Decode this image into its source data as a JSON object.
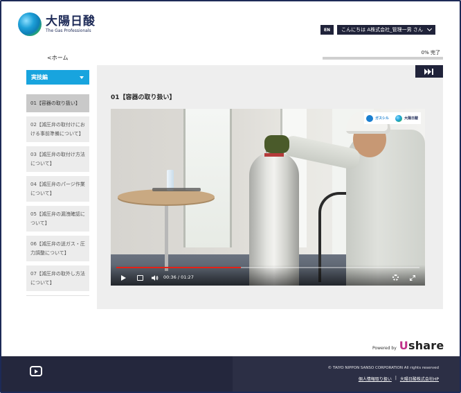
{
  "header": {
    "logo_jp": "大陽日酸",
    "logo_en": "The Gas Professionals",
    "lang_button": "EN",
    "user_greeting": "こんにちは A株式会社_管理一男 さん"
  },
  "nav": {
    "home_link": "<ホーム"
  },
  "progress": {
    "label": "0% 完了",
    "value": 0
  },
  "sidebar": {
    "section_dropdown": "実技編",
    "lessons": [
      {
        "label": "01【容器の取り扱い】",
        "active": true
      },
      {
        "label": "02【減圧弁の取付けにおける事前準備について】",
        "active": false
      },
      {
        "label": "03【減圧弁の取付け方法について】",
        "active": false
      },
      {
        "label": "04【減圧弁のパージ作業について】",
        "active": false
      },
      {
        "label": "05【減圧弁の漏洩確認について】",
        "active": false
      },
      {
        "label": "06【減圧弁の送ガス・圧力調整について】",
        "active": false
      },
      {
        "label": "07【減圧弁の取外し方法について】",
        "active": false
      }
    ]
  },
  "main": {
    "lesson_title": "01【容器の取り扱い】",
    "video": {
      "current_time": "00:36",
      "separator": "/",
      "duration": "01:27",
      "progress": 0.41,
      "overlay_logo_left": "ガスシル",
      "overlay_logo_right": "大陽日酸"
    }
  },
  "footer": {
    "powered_by": "Powered by",
    "brand": "Ushare",
    "copyright": "© TAIYO NIPPON SANSO CORPORATION All rights reserved",
    "links": [
      "個人情報取り扱い",
      "大陽日酸株式会社HP"
    ],
    "link_separator": "|"
  },
  "colors": {
    "accent": "#18a4de",
    "dark": "#20233a",
    "footer": "#24273d"
  }
}
